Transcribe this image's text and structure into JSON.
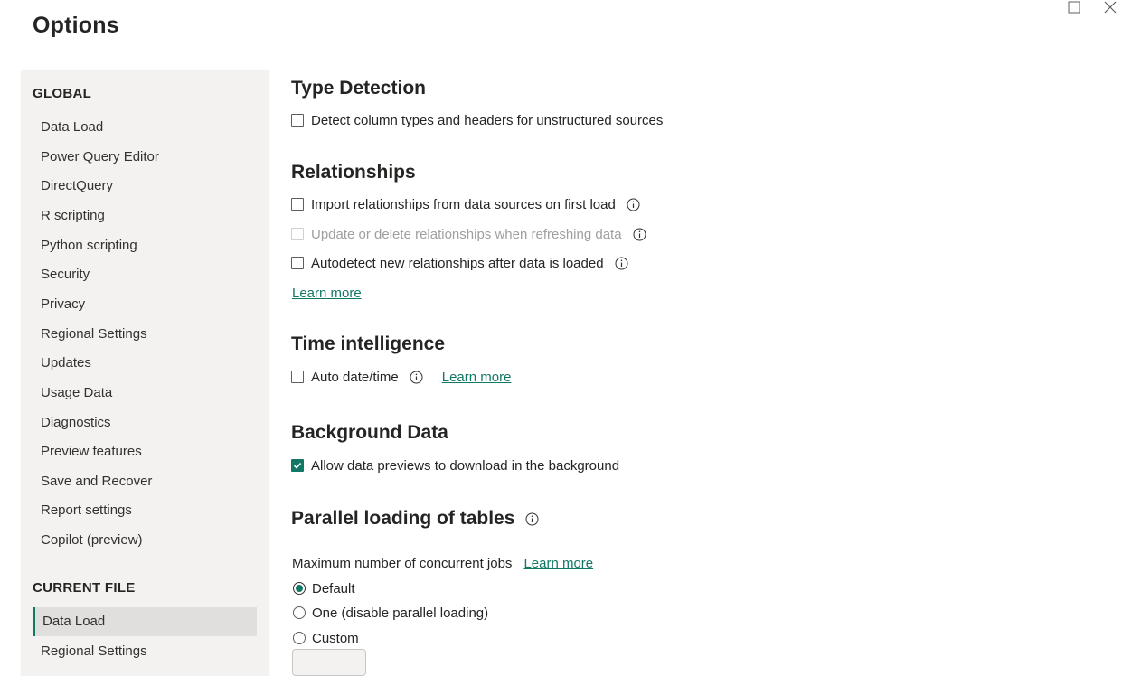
{
  "dialog": {
    "title": "Options"
  },
  "window_controls": {
    "maximize_icon": "maximize-icon",
    "close_icon": "close-icon"
  },
  "sidebar": {
    "global_heading": "GLOBAL",
    "global_items": [
      {
        "label": "Data Load"
      },
      {
        "label": "Power Query Editor"
      },
      {
        "label": "DirectQuery"
      },
      {
        "label": "R scripting"
      },
      {
        "label": "Python scripting"
      },
      {
        "label": "Security"
      },
      {
        "label": "Privacy"
      },
      {
        "label": "Regional Settings"
      },
      {
        "label": "Updates"
      },
      {
        "label": "Usage Data"
      },
      {
        "label": "Diagnostics"
      },
      {
        "label": "Preview features"
      },
      {
        "label": "Save and Recover"
      },
      {
        "label": "Report settings"
      },
      {
        "label": "Copilot (preview)"
      }
    ],
    "current_file_heading": "CURRENT FILE",
    "current_file_items": [
      {
        "label": "Data Load",
        "selected": true
      },
      {
        "label": "Regional Settings",
        "selected": false
      }
    ]
  },
  "type_detection": {
    "title": "Type Detection",
    "detect_column_types": {
      "label": "Detect column types and headers for unstructured sources",
      "checked": false
    }
  },
  "relationships": {
    "title": "Relationships",
    "import_relationships": {
      "label": "Import relationships from data sources on first load",
      "checked": false
    },
    "update_delete": {
      "label": "Update or delete relationships when refreshing data",
      "checked": false,
      "disabled": true
    },
    "autodetect": {
      "label": "Autodetect new relationships after data is loaded",
      "checked": false
    },
    "learn_more": "Learn more"
  },
  "time_intelligence": {
    "title": "Time intelligence",
    "auto_datetime": {
      "label": "Auto date/time",
      "checked": false
    },
    "learn_more": "Learn more"
  },
  "background_data": {
    "title": "Background Data",
    "allow_previews": {
      "label": "Allow data previews to download in the background",
      "checked": true
    }
  },
  "parallel_loading": {
    "title": "Parallel loading of tables",
    "max_jobs_label": "Maximum number of concurrent jobs",
    "learn_more": "Learn more",
    "options": [
      {
        "label": "Default",
        "selected": true
      },
      {
        "label": "One (disable parallel loading)",
        "selected": false
      },
      {
        "label": "Custom",
        "selected": false
      }
    ]
  },
  "colors": {
    "accent": "#117865",
    "sidebar_bg": "#f3f2f1",
    "selected_bg": "#e1dfdd",
    "text": "#252423",
    "disabled_text": "#a19f9d"
  }
}
